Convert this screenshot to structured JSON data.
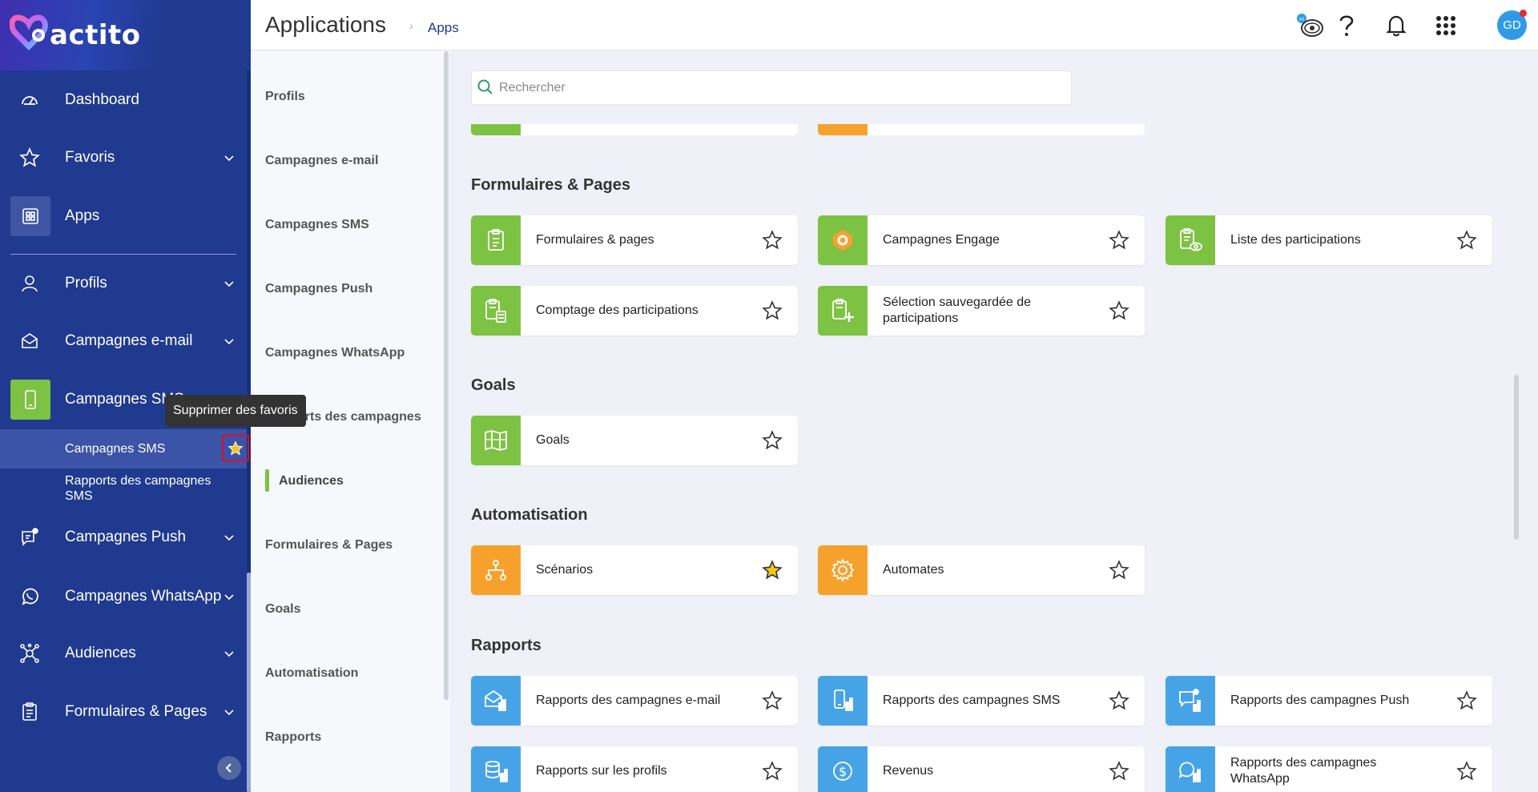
{
  "brand": {
    "name": "actito"
  },
  "sidebar": {
    "items": [
      {
        "label": "Dashboard",
        "icon": "dashboard-icon"
      },
      {
        "label": "Favoris",
        "icon": "star-icon"
      },
      {
        "label": "Apps",
        "icon": "apps-grid-icon"
      },
      {
        "label": "Profils",
        "icon": "user-icon"
      },
      {
        "label": "Campagnes e-mail",
        "icon": "envelope-icon"
      },
      {
        "label": "Campagnes SMS",
        "icon": "phone-icon"
      },
      {
        "label": "Campagnes Push",
        "icon": "push-icon"
      },
      {
        "label": "Campagnes WhatsApp",
        "icon": "whatsapp-icon"
      },
      {
        "label": "Audiences",
        "icon": "audiences-icon"
      },
      {
        "label": "Formulaires & Pages",
        "icon": "clipboard-icon"
      }
    ],
    "sms_subitems": [
      "Campagnes SMS",
      "Rapports des campagnes SMS"
    ],
    "tooltip": "Supprimer des favoris"
  },
  "header": {
    "title": "Applications",
    "breadcrumb": "Apps",
    "avatar_initials": "GD"
  },
  "categories": [
    "Profils",
    "Campagnes e-mail",
    "Campagnes SMS",
    "Campagnes Push",
    "Campagnes WhatsApp",
    "Rapports des campagnes",
    "Audiences",
    "Formulaires & Pages",
    "Goals",
    "Automatisation",
    "Rapports"
  ],
  "search": {
    "placeholder": "Rechercher",
    "value": ""
  },
  "sections": {
    "formulaires": {
      "title": "Formulaires & Pages",
      "cards": [
        "Formulaires & pages",
        "Campagnes Engage",
        "Liste des participations",
        "Comptage des participations",
        "Sélection sauvegardée de participations"
      ]
    },
    "goals": {
      "title": "Goals",
      "cards": [
        "Goals"
      ]
    },
    "automatisation": {
      "title": "Automatisation",
      "cards": [
        "Scénarios",
        "Automates"
      ]
    },
    "rapports": {
      "title": "Rapports",
      "cards": [
        "Rapports des campagnes e-mail",
        "Rapports des campagnes SMS",
        "Rapports des campagnes Push",
        "Rapports sur les profils",
        "Revenus",
        "Rapports des campagnes WhatsApp"
      ]
    }
  },
  "colors": {
    "sidebar": "#1f3a8e",
    "green": "#7dc242",
    "orange": "#f7a12d",
    "blue": "#46a4e6",
    "favorite": "#f5c518"
  }
}
